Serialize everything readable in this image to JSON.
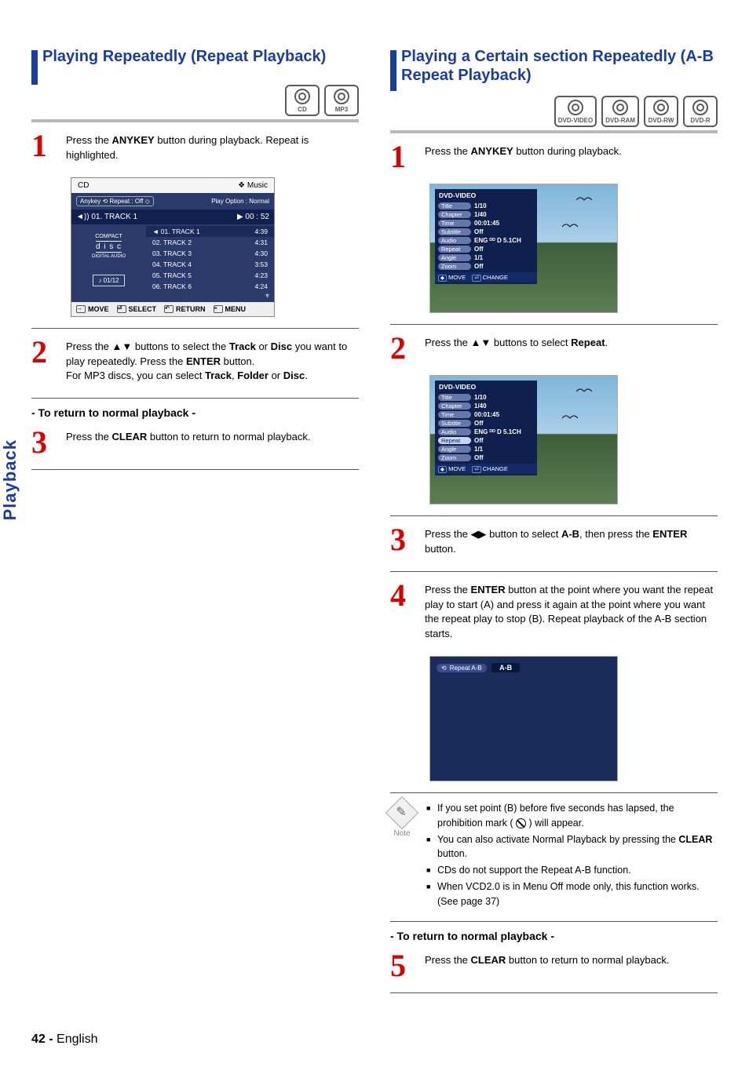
{
  "side_tab": "Playback",
  "page_number": "42 -",
  "page_lang": "English",
  "left": {
    "title": "Playing Repeatedly (Repeat Playback)",
    "badges": [
      "CD",
      "MP3"
    ],
    "step1_a": "Press the ",
    "step1_key": "ANYKEY",
    "step1_b": " button during playback. Repeat is highlighted.",
    "step2_a": "Press the ",
    "step2_b": " buttons to select the ",
    "step2_track": "Track",
    "step2_or": " or ",
    "step2_disc": "Disc",
    "step2_c": " you want to play repeatedly. Press the ",
    "step2_enter": "ENTER",
    "step2_d": " button.",
    "step2_e": "For MP3 discs, you can select ",
    "step2_f": "Track",
    "step2_g": ", ",
    "step2_h": "Folder",
    "step2_i": " or ",
    "step2_j": "Disc",
    "step2_k": ".",
    "return_head": "- To return to normal playback -",
    "step3_a": "Press the ",
    "step3_key": "CLEAR",
    "step3_b": " button to return to normal playback.",
    "osd": {
      "top_left": "CD",
      "top_right": "Music",
      "anykey": "Anykey",
      "repeat": "Repeat : Off",
      "play_option": "Play Option : Normal",
      "now_track": "01. TRACK 1",
      "now_time": "00 : 52",
      "counter": "01/12",
      "tracks": [
        {
          "n": "01. TRACK 1",
          "t": "4:39"
        },
        {
          "n": "02. TRACK 2",
          "t": "4:31"
        },
        {
          "n": "03. TRACK 3",
          "t": "4:30"
        },
        {
          "n": "04. TRACK 4",
          "t": "3:53"
        },
        {
          "n": "05. TRACK 5",
          "t": "4:23"
        },
        {
          "n": "06. TRACK 6",
          "t": "4:24"
        }
      ],
      "foot": [
        "MOVE",
        "SELECT",
        "RETURN",
        "MENU"
      ]
    }
  },
  "right": {
    "title": "Playing a Certain section Repeatedly (A-B Repeat Playback)",
    "badges": [
      "DVD-VIDEO",
      "DVD-RAM",
      "DVD-RW",
      "DVD-R"
    ],
    "step1_a": "Press the ",
    "step1_key": "ANYKEY",
    "step1_b": " button during playback.",
    "step2_a": "Press the ",
    "step2_b": " buttons to select ",
    "step2_repeat": "Repeat",
    "step2_c": ".",
    "step3_a": "Press the ",
    "step3_b": " button to select ",
    "step3_ab": "A-B",
    "step3_c": ", then press the ",
    "step3_enter": "ENTER",
    "step3_d": " button.",
    "step4_a": "Press the ",
    "step4_enter": "ENTER",
    "step4_b": " button at the point where you want the repeat play to start (A) and press it again at the point where you want the repeat play to stop (B). Repeat playback of the A-B section starts.",
    "info": {
      "title": "DVD-VIDEO",
      "rows": [
        {
          "tag": "Title",
          "val": "1/10"
        },
        {
          "tag": "Chapter",
          "val": "1/40"
        },
        {
          "tag": "Time",
          "val": "00:01:45"
        },
        {
          "tag": "Subtitle",
          "val": "Off"
        },
        {
          "tag": "Audio",
          "val": "ENG ᴰᴰ D  5.1CH"
        },
        {
          "tag": "Repeat",
          "val": "Off"
        },
        {
          "tag": "Angle",
          "val": "1/1"
        },
        {
          "tag": "Zoom",
          "val": "Off"
        }
      ],
      "foot_move": "MOVE",
      "foot_change": "CHANGE"
    },
    "ab_box": {
      "pill": "Repeat  A-B",
      "val": "A-B"
    },
    "notes_label": "Note",
    "notes": {
      "n1_a": "If you set point (B) before five seconds has lapsed, the prohibition mark ( ",
      "n1_b": " ) will appear.",
      "n2_a": "You can also activate Normal Playback by pressing the ",
      "n2_key": "CLEAR",
      "n2_b": " button.",
      "n3": "CDs do not support the Repeat A-B function.",
      "n4": "When VCD2.0 is in Menu Off mode only, this function works. (See page 37)"
    },
    "return_head": "- To return to normal playback -",
    "step5_a": "Press the ",
    "step5_key": "CLEAR",
    "step5_b": " button to return to normal playback."
  }
}
